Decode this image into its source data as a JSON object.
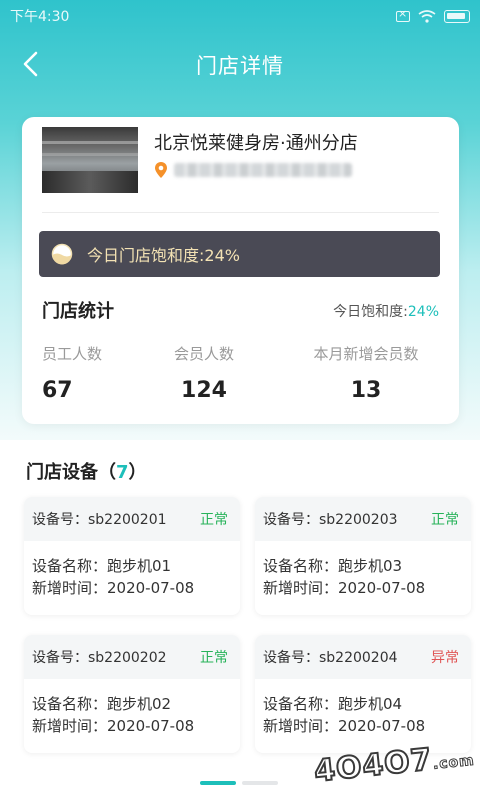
{
  "status_bar": {
    "time": "下午4:30"
  },
  "nav": {
    "title": "门店详情"
  },
  "store": {
    "name": "北京悦莱健身房·通州分店",
    "saturation_banner": "今日门店饱和度:24%"
  },
  "stats": {
    "title": "门店统计",
    "today_label": "今日饱和度:",
    "today_value": "24%",
    "items": [
      {
        "label": "员工人数",
        "value": "67"
      },
      {
        "label": "会员人数",
        "value": "124"
      },
      {
        "label": "本月新增会员数",
        "value": "13"
      }
    ]
  },
  "equipment": {
    "title": "门店设备",
    "count": "7",
    "open_paren": "（",
    "close_paren": "）",
    "devices": [
      {
        "id_label": "设备号：sb2200201",
        "status": "正常",
        "name": "设备名称：跑步机01",
        "added": "新增时间：2020-07-08"
      },
      {
        "id_label": "设备号：sb2200203",
        "status": "正常",
        "name": "设备名称：跑步机03",
        "added": "新增时间：2020-07-08"
      },
      {
        "id_label": "设备号：sb2200202",
        "status": "正常",
        "name": "设备名称：跑步机02",
        "added": "新增时间：2020-07-08"
      },
      {
        "id_label": "设备号：sb2200204",
        "status": "异常",
        "name": "设备名称：跑步机04",
        "added": "新增时间：2020-07-08"
      }
    ]
  },
  "watermark": {
    "text": "4O4O7",
    "suffix": ".com"
  },
  "colors": {
    "accent": "#1dbfba",
    "normal": "#27b35a",
    "abnormal": "#e05555",
    "banner": "#4a4a55"
  }
}
